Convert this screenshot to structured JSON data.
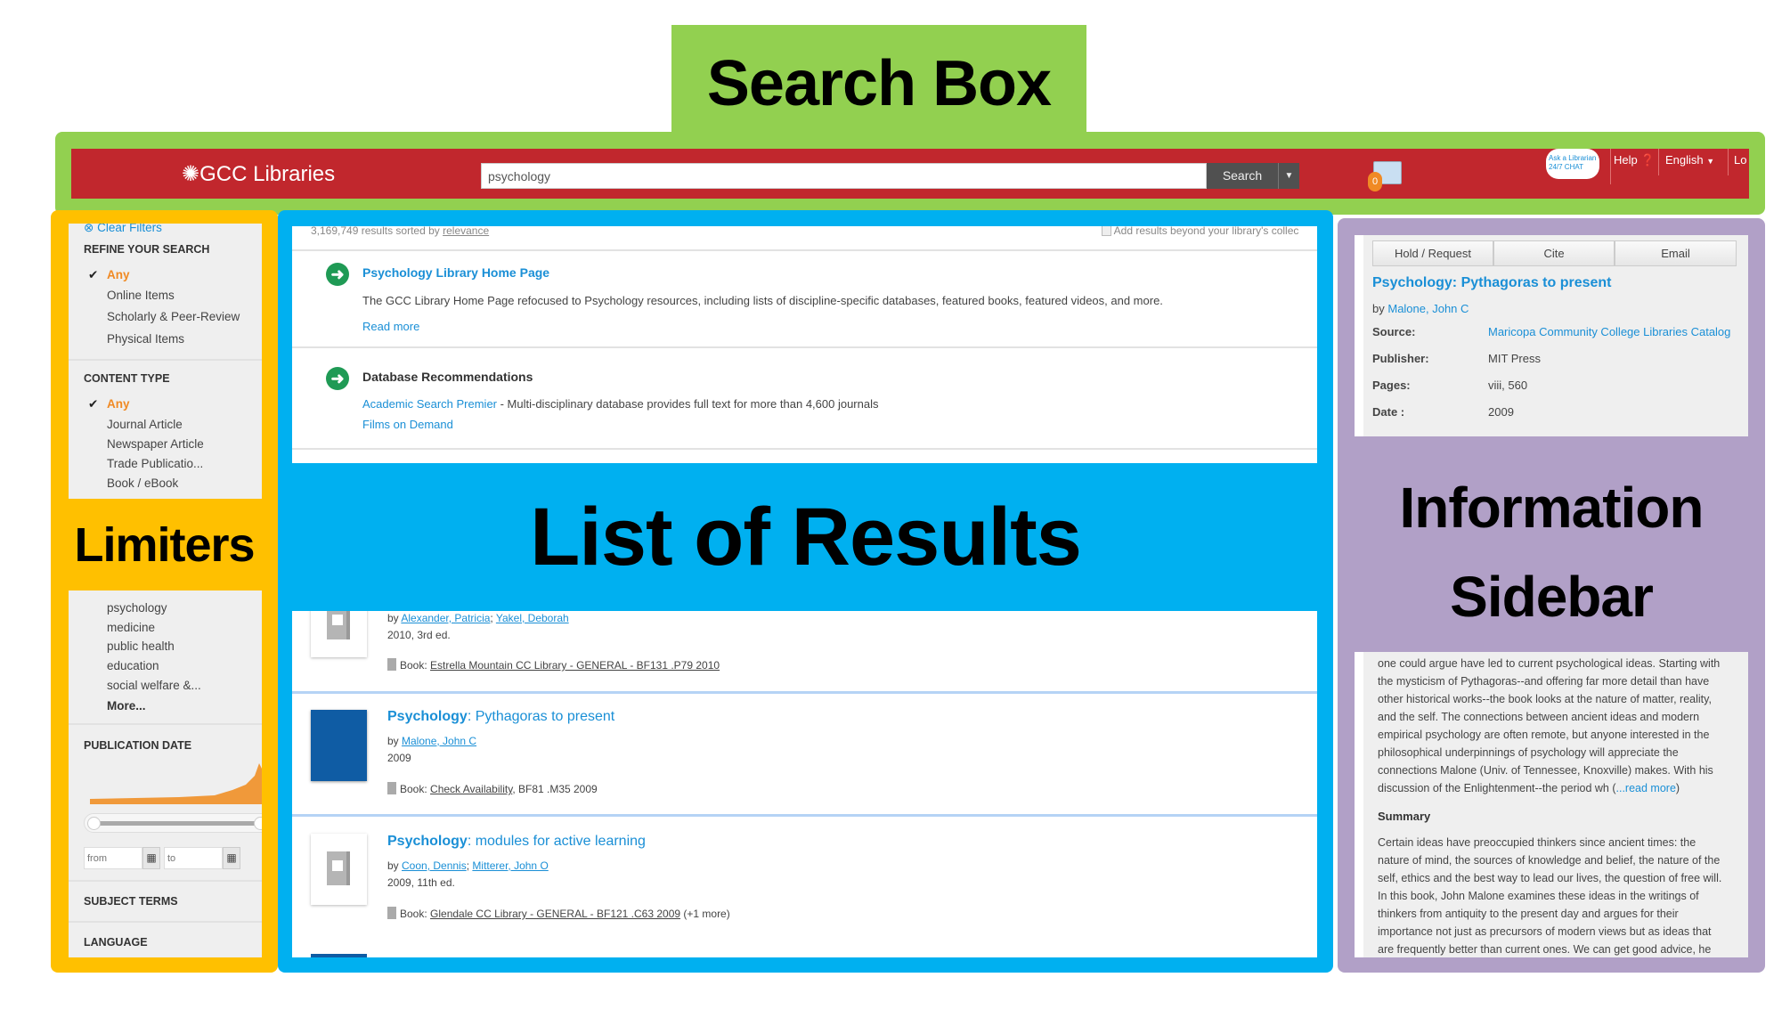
{
  "annotations": {
    "search_box": "Search Box",
    "limiters": "Limiters",
    "list_of_results": "List of Results",
    "information_sidebar_line1": "Information",
    "information_sidebar_line2": "Sidebar"
  },
  "colors": {
    "search_box_frame": "#92d050",
    "limiters_frame": "#ffc000",
    "results_frame": "#00b0f0",
    "sidebar_frame": "#b1a0c7",
    "header_red": "#c1272d",
    "link_blue": "#1a8fd6",
    "accent_orange": "#f08a24"
  },
  "header": {
    "logo": "GCC Libraries",
    "search_value": "psychology",
    "search_button": "Search",
    "folder_count": "0",
    "ask_librarian": "Ask a Librarian 24/7 CHAT",
    "help": "Help",
    "language": "English",
    "login": "Lo"
  },
  "filters": {
    "clear_filters": "Clear Filters",
    "refine_title": "REFINE YOUR SEARCH",
    "refine_items": [
      "Any",
      "Online Items",
      "Scholarly & Peer-Review",
      "Physical Items"
    ],
    "content_type_title": "CONTENT TYPE",
    "content_items": [
      "Any",
      "Journal Article",
      "Newspaper Article",
      "Trade Publicatio...",
      "Book / eBook"
    ],
    "discipline_items": [
      "psychology",
      "medicine",
      "public health",
      "education",
      "social welfare &...",
      "More..."
    ],
    "pub_date_title": "PUBLICATION DATE",
    "from_placeholder": "from",
    "to_placeholder": "to",
    "subject_terms": "SUBJECT TERMS",
    "language": "LANGUAGE"
  },
  "results": {
    "count_text": "3,169,749 results sorted by",
    "sort": "relevance",
    "beyond_label": "Add results beyond your library's collec",
    "recommendations": [
      {
        "title": "Psychology Library Home Page",
        "description": "The GCC Library Home Page refocused to Psychology resources, including lists of discipline-specific databases, featured books, featured videos, and more.",
        "link": "Read more"
      },
      {
        "title": "Database Recommendations",
        "db_link": "Academic Search Premier",
        "db_desc": " - Multi-disciplinary database provides full text for more than 4,600 journals",
        "link2": "Films on Demand"
      }
    ],
    "items": [
      {
        "authors": [
          "Alexander, Patricia",
          "Yakel, Deborah"
        ],
        "edition": "2010, 3rd ed.",
        "format": "Book:",
        "location": "Estrella Mountain CC Library - GENERAL - BF131 .P79 2010",
        "extra": ""
      },
      {
        "title_bold": "Psychology",
        "title_rest": ": Pythagoras to present",
        "authors": [
          "Malone, John C"
        ],
        "edition": "2009",
        "format": "Book:",
        "location": "Check Availability",
        "extra": ", BF81 .M35 2009"
      },
      {
        "title_bold": "Psychology",
        "title_rest": ": modules for active learning",
        "authors": [
          "Coon, Dennis",
          "Mitterer, John O"
        ],
        "edition": "2009, 11th ed.",
        "format": "Book:",
        "location": "Glendale CC Library - GENERAL - BF121 .C63 2009",
        "extra": " (+1 more)"
      }
    ]
  },
  "sidebar": {
    "buttons": [
      "Hold / Request",
      "Cite",
      "Email"
    ],
    "title": "Psychology: Pythagoras to present",
    "by": "by",
    "author": "Malone, John C",
    "fields": [
      {
        "label": "Source:",
        "value": "Maricopa Community College Libraries Catalog"
      },
      {
        "label": "Publisher:",
        "value": "MIT Press"
      },
      {
        "label": "Pages:",
        "value": "viii, 560"
      },
      {
        "label": "Date :",
        "value": "2009"
      }
    ],
    "review_lines": [
      "one could argue have led to current psychological ideas. Starting with",
      "the mysticism of Pythagoras--and offering far more detail than have",
      "other historical works--the book looks at the nature of matter, reality,",
      "and the self. The connections between ancient ideas and modern",
      "empirical psychology are often remote, but anyone interested in the",
      "philosophical underpinnings of psychology will appreciate the",
      "connections Malone (Univ. of Tennessee, Knoxville) makes. With his",
      "discussion of the Enlightenment--the period wh ("
    ],
    "read_more": "...read more",
    "read_more_close": ")",
    "summary_title": "Summary",
    "summary_lines": [
      "Certain ideas have preoccupied thinkers since ancient times: the",
      "nature of mind, the sources of knowledge and belief, the nature of the",
      "self, ethics and the best way to lead our lives, the question of free will.",
      "In this book, John Malone examines these ideas in the writings of",
      "thinkers from antiquity to the present day and argues for their",
      "importance not just as precursors of modern views but as ideas that",
      "are frequently better than current ones. We can get good advice, he"
    ]
  }
}
